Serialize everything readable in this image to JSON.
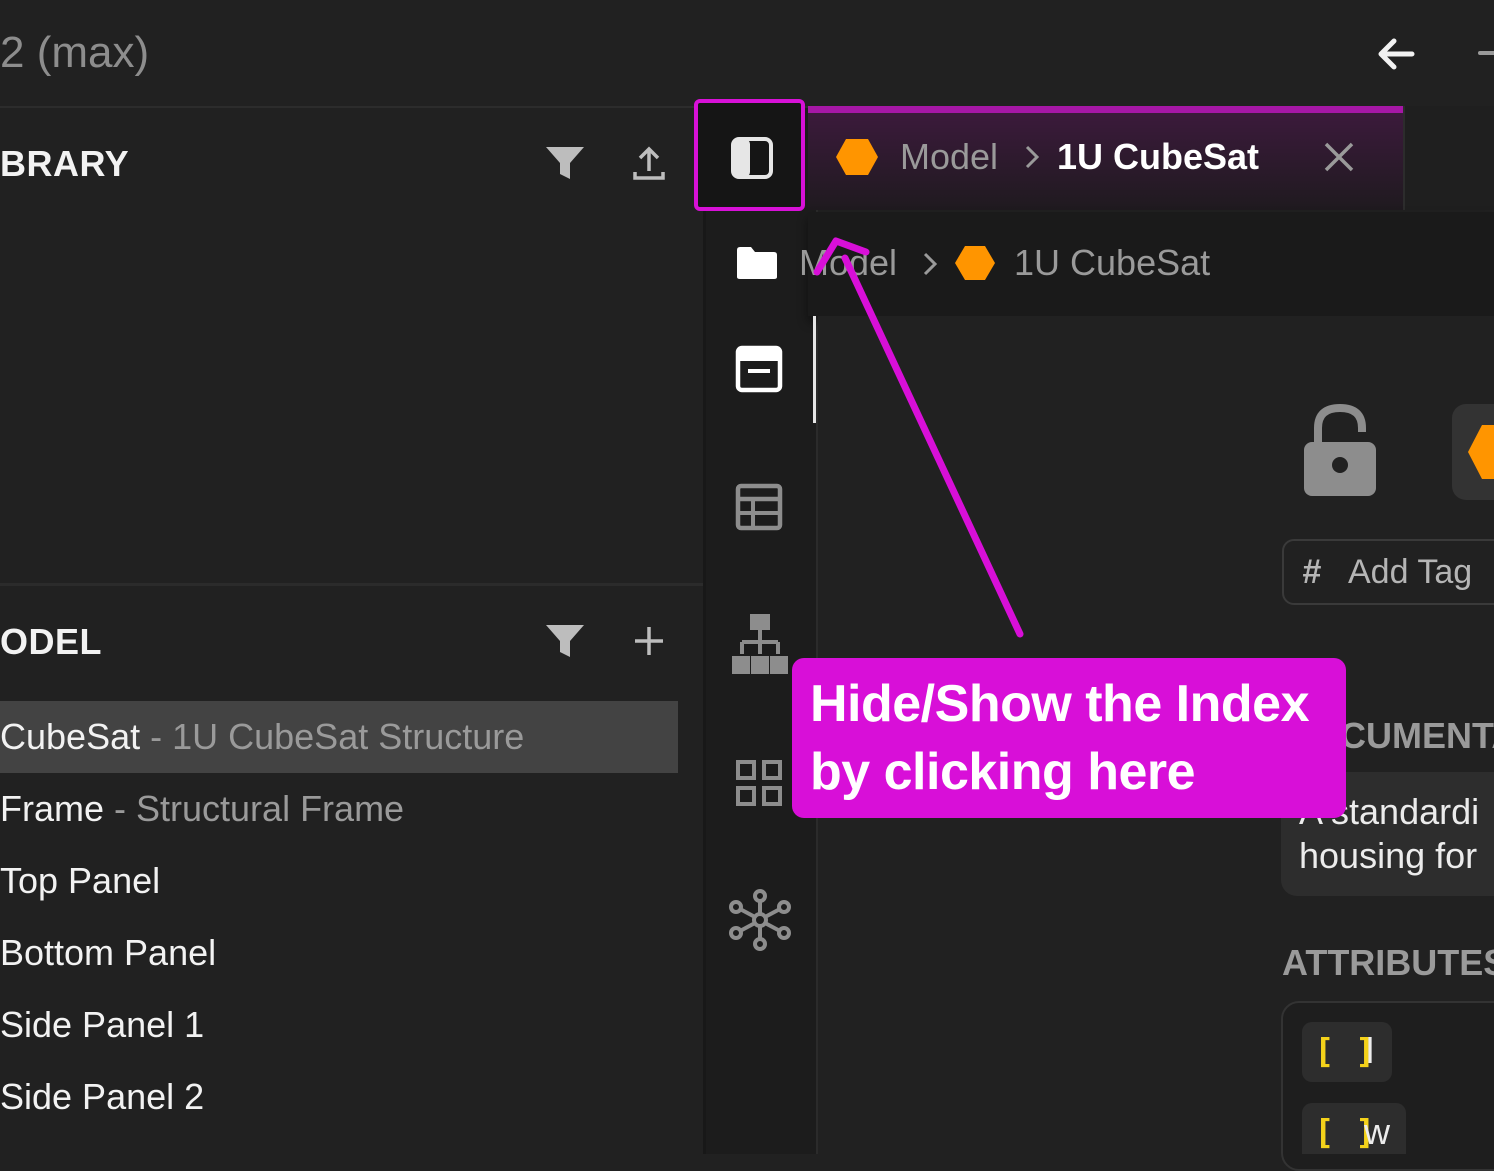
{
  "window": {
    "title": "2 (max)"
  },
  "library": {
    "title": "BRARY"
  },
  "model": {
    "title": "ODEL",
    "items": [
      {
        "name": "CubeSat",
        "desc": " - 1U CubeSat Structure",
        "selected": true
      },
      {
        "name": "Frame",
        "desc": " - Structural Frame"
      },
      {
        "name": "Top Panel",
        "desc": ""
      },
      {
        "name": "Bottom Panel",
        "desc": ""
      },
      {
        "name": "Side Panel 1",
        "desc": ""
      },
      {
        "name": "Side Panel 2",
        "desc": ""
      }
    ]
  },
  "tab": {
    "parent": "Model",
    "sep": ">",
    "current": "1U CubeSat",
    "close": "✕"
  },
  "breadcrumb": {
    "parent": "Model",
    "sep": ">",
    "current": "1U CubeSat"
  },
  "content": {
    "add_tag": "Add Tag",
    "add_tag_symbol": "#",
    "doc_heading": "CUMENTA",
    "doc_text_line1": "A standardi",
    "doc_text_line2": "housing for",
    "attributes_heading": "ATTRIBUTES",
    "attributes": [
      {
        "bracket": "[ ]",
        "name": "l"
      },
      {
        "bracket": "[ ]",
        "name": "w"
      }
    ]
  },
  "callout": {
    "line1": "Hide/Show the Index",
    "line2": "by clicking here"
  },
  "colors": {
    "accent": "#d80fd8",
    "hex_orange": "#ff9500",
    "bracket_yellow": "#f4d21a"
  }
}
